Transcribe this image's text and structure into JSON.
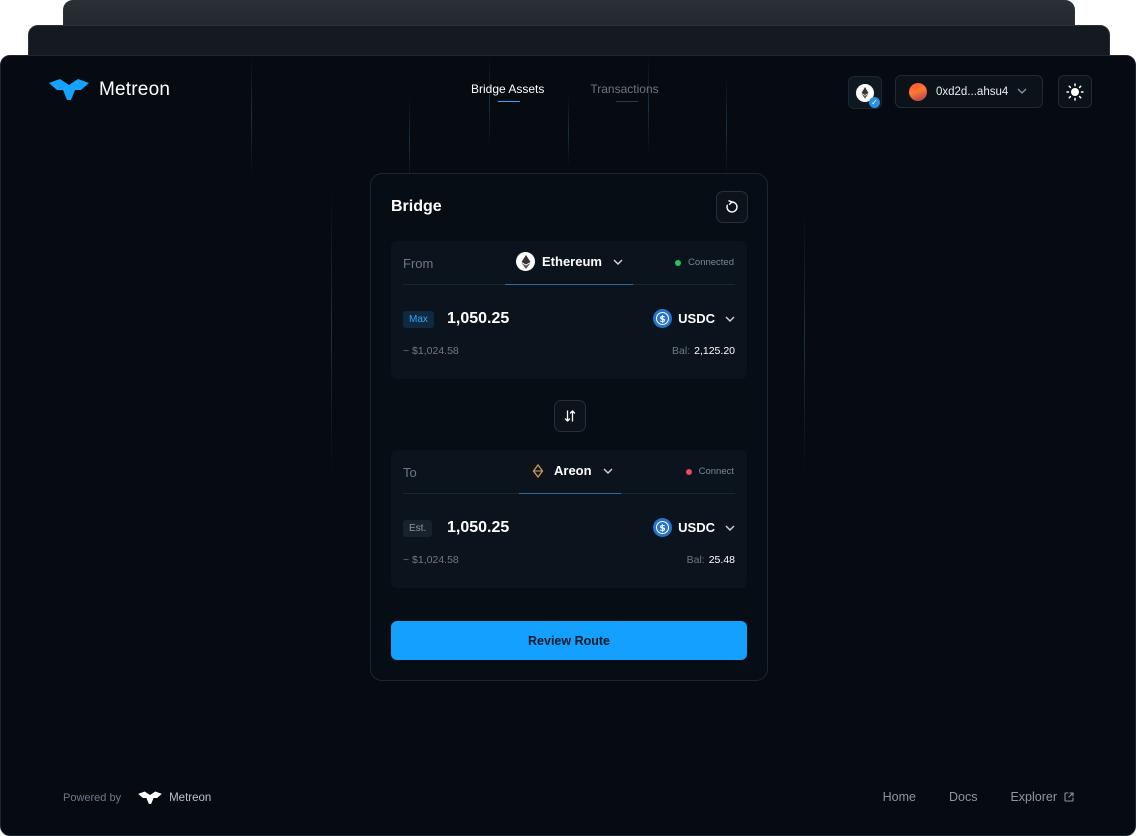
{
  "brand": {
    "name": "Metreon"
  },
  "nav": {
    "tabs": [
      {
        "label": "Bridge Assets",
        "active": true
      },
      {
        "label": "Transactions",
        "active": false
      }
    ]
  },
  "header": {
    "wallet_address": "0xd2d...ahsu4",
    "chain_icon": "ethereum-icon",
    "theme_icon": "sun-icon"
  },
  "bridge": {
    "title": "Bridge",
    "from": {
      "label": "From",
      "chain": "Ethereum",
      "status": "Connected",
      "status_color": "#22c55e",
      "badge": "Max",
      "amount": "1,050.25",
      "token": "USDC",
      "usd_value": "~ $1,024.58",
      "balance_label": "Bal:",
      "balance": "2,125.20"
    },
    "to": {
      "label": "To",
      "chain": "Areon",
      "status": "Connect",
      "status_color": "#f04a5a",
      "badge": "Est.",
      "amount": "1,050.25",
      "token": "USDC",
      "usd_value": "~ $1,024.58",
      "balance_label": "Bal:",
      "balance": "25.48"
    },
    "review_button": "Review Route"
  },
  "footer": {
    "powered_by": "Powered by",
    "brand": "Metreon",
    "links": [
      "Home",
      "Docs",
      "Explorer"
    ]
  },
  "colors": {
    "accent": "#13a0ff",
    "background": "#060b11"
  }
}
